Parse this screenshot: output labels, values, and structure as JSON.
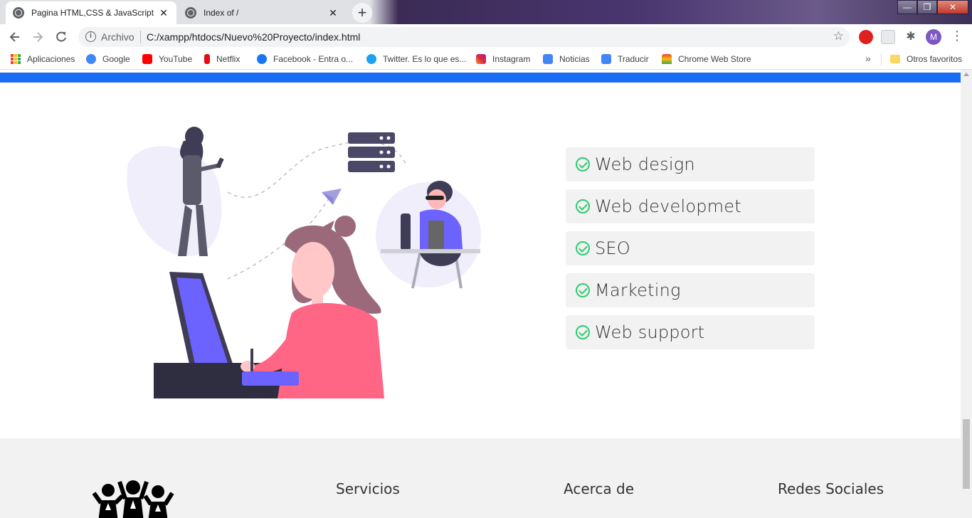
{
  "browser": {
    "tabs": [
      {
        "title": "Pagina HTML,CSS & JavaScript",
        "active": true
      },
      {
        "title": "Index of /",
        "active": false
      }
    ],
    "close_glyph": "✕",
    "newtab_glyph": "+",
    "window_controls": {
      "minimize": "—",
      "maximize": "❐",
      "close": "✕"
    },
    "address": {
      "security_label": "Archivo",
      "url": "C:/xampp/htdocs/Nuevo%20Proyecto/index.html"
    },
    "profile_initial": "M",
    "bookmarks": [
      {
        "label": "Aplicaciones",
        "icon": "apps-icon"
      },
      {
        "label": "Google",
        "icon": "google-icon",
        "color": "#4285f4"
      },
      {
        "label": "YouTube",
        "icon": "youtube-icon",
        "color": "#ff0000"
      },
      {
        "label": "Netflix",
        "icon": "netflix-icon",
        "color": "#e50914"
      },
      {
        "label": "Facebook - Entra o...",
        "icon": "facebook-icon",
        "color": "#1877f2"
      },
      {
        "label": "Twitter. Es lo que es...",
        "icon": "twitter-icon",
        "color": "#1da1f2"
      },
      {
        "label": "Instagram",
        "icon": "instagram-icon",
        "color": "#d6249f"
      },
      {
        "label": "Noticias",
        "icon": "news-icon",
        "color": "#4285f4"
      },
      {
        "label": "Traducir",
        "icon": "translate-icon",
        "color": "#4285f4"
      },
      {
        "label": "Chrome Web Store",
        "icon": "chrome-web-store-icon",
        "color": "#ea4335"
      }
    ],
    "bookmarks_overflow": "»",
    "other_bookmarks": "Otros favoritos"
  },
  "page": {
    "accent_color": "#1a6cf5",
    "check_color": "#2ecc71",
    "services": [
      "Web design",
      "Web developmet",
      "SEO",
      "Marketing",
      "Web support"
    ],
    "footer": {
      "headings": [
        "Servicios",
        "Acerca de",
        "Redes Sociales"
      ]
    }
  }
}
